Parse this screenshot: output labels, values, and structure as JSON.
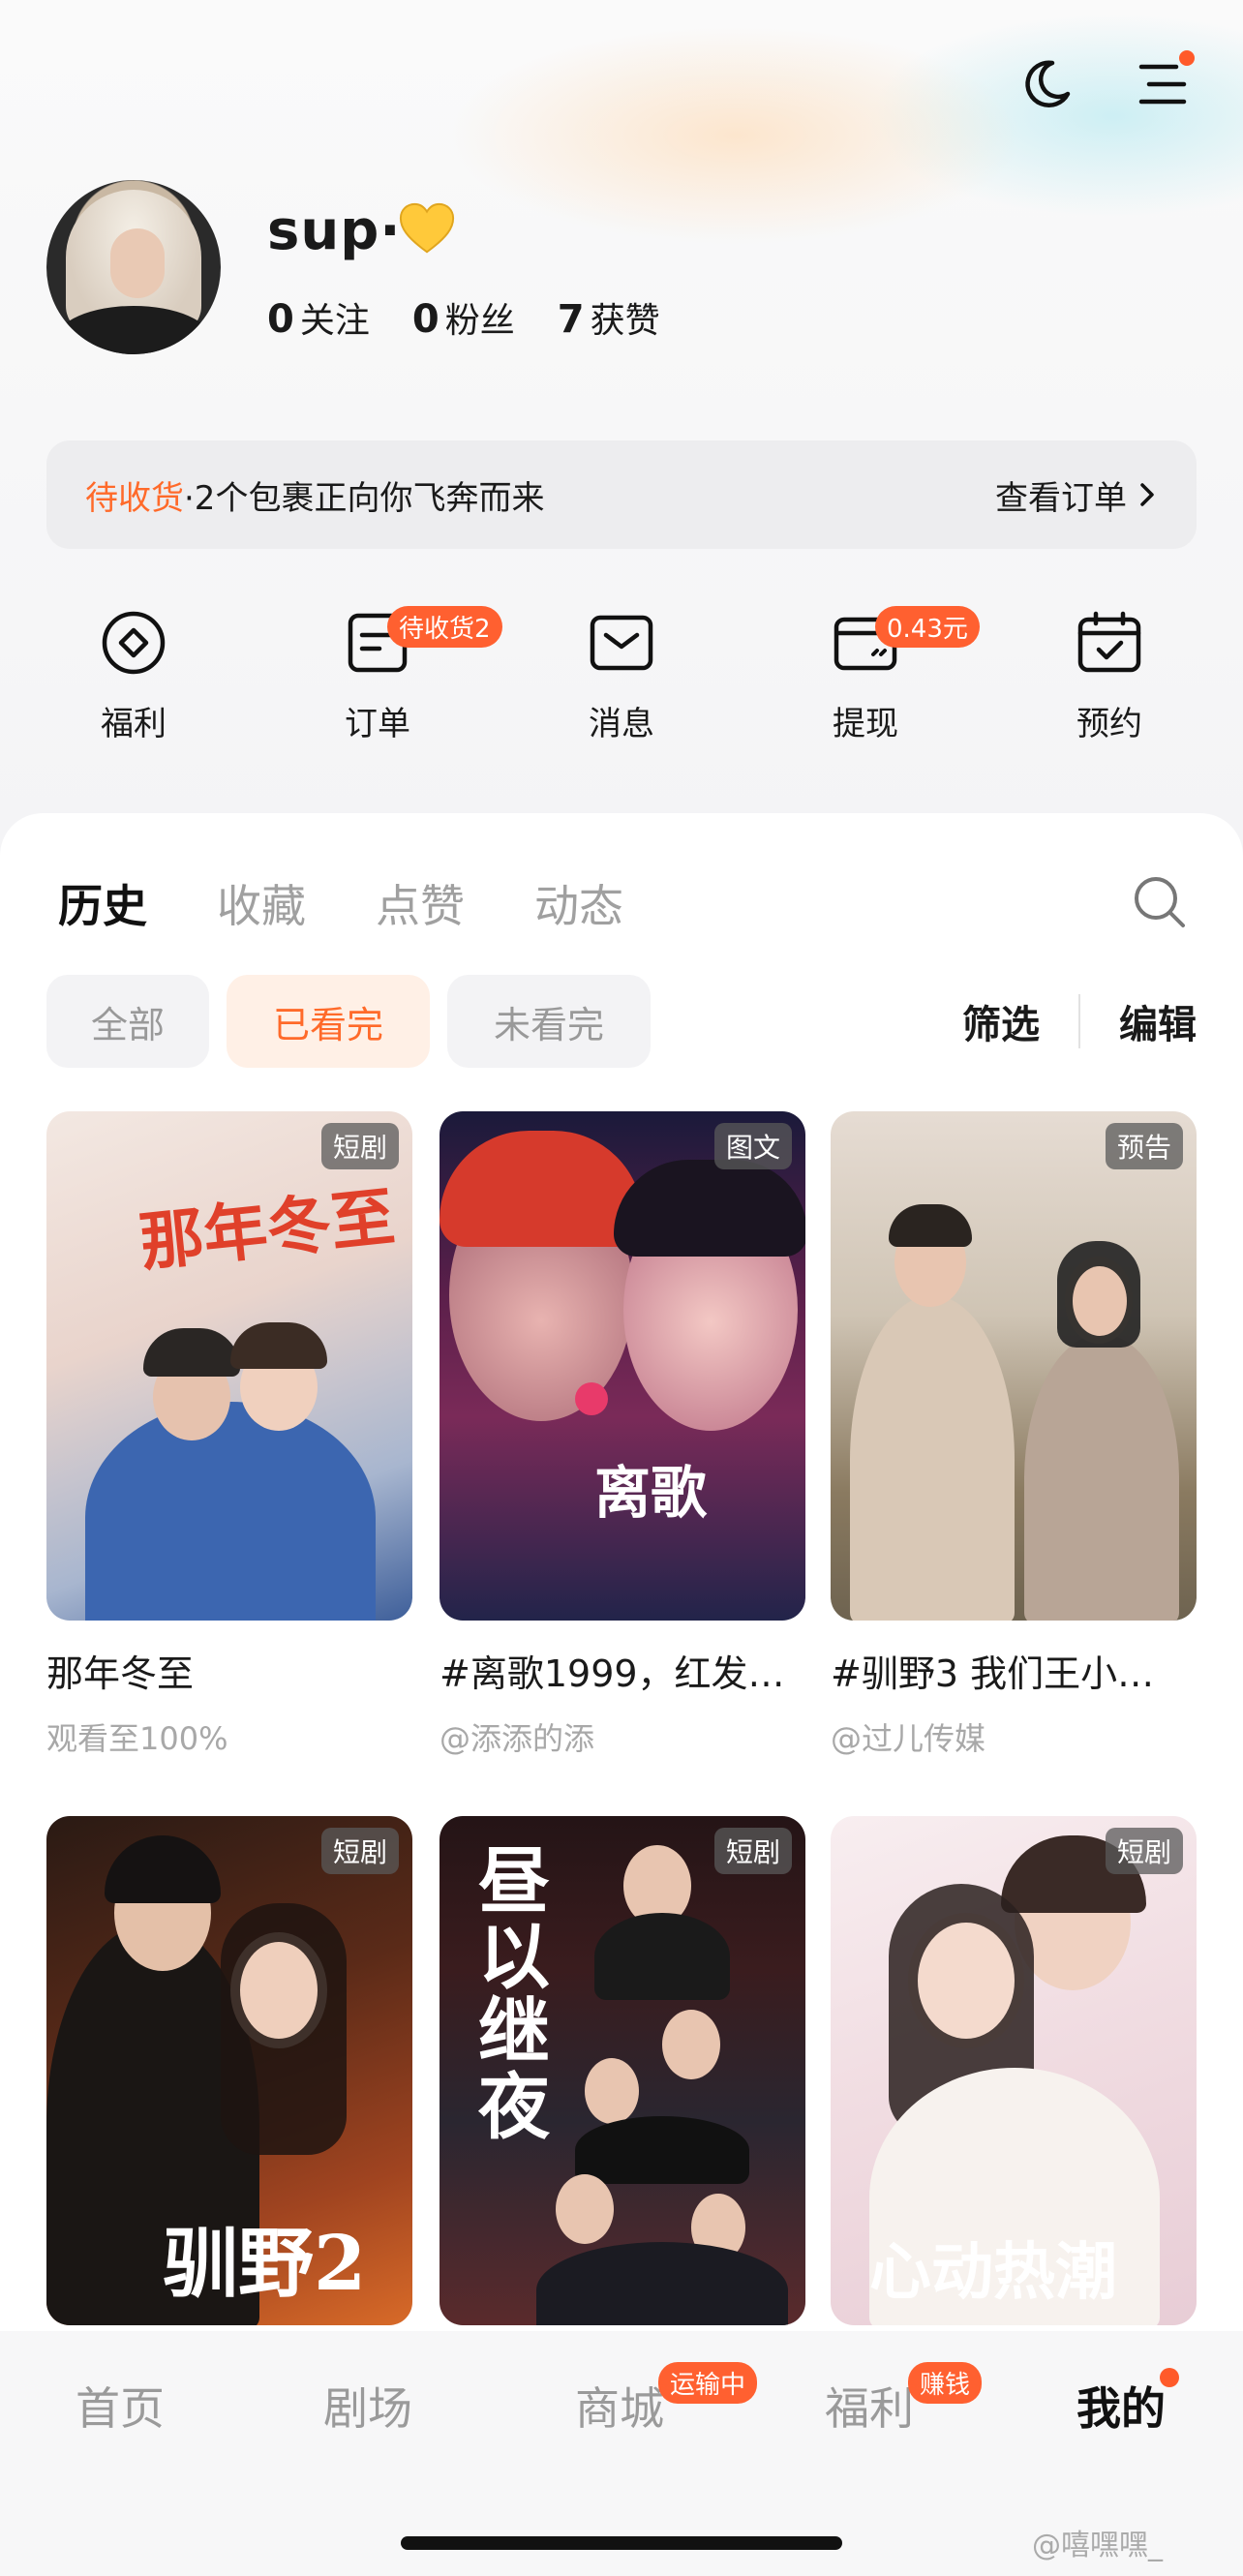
{
  "header": {
    "dark_mode_icon": "moon-icon",
    "menu_icon": "menu-icon"
  },
  "profile": {
    "username": "sup·",
    "stats": [
      {
        "num": "0",
        "label": "关注"
      },
      {
        "num": "0",
        "label": "粉丝"
      },
      {
        "num": "7",
        "label": "获赞"
      }
    ]
  },
  "banner": {
    "status": "待收货",
    "message": "·2个包裹正向你飞奔而来",
    "action": "查看订单"
  },
  "shortcuts": [
    {
      "label": "福利",
      "icon": "coin-icon",
      "badge": ""
    },
    {
      "label": "订单",
      "icon": "order-icon",
      "badge": "待收货2"
    },
    {
      "label": "消息",
      "icon": "message-icon",
      "badge": ""
    },
    {
      "label": "提现",
      "icon": "wallet-icon",
      "badge": "0.43元"
    },
    {
      "label": "预约",
      "icon": "calendar-icon",
      "badge": ""
    }
  ],
  "tabs": [
    "历史",
    "收藏",
    "点赞",
    "动态"
  ],
  "filters": {
    "chips": [
      "全部",
      "已看完",
      "未看完"
    ],
    "screen": "筛选",
    "edit": "编辑"
  },
  "items": [
    {
      "tag": "短剧",
      "title": "那年冬至",
      "sub": "观看至100%",
      "poster_text": "那年冬至"
    },
    {
      "tag": "图文",
      "title": "#离歌1999，红发…",
      "sub": "@添添的添",
      "poster_text": "离歌"
    },
    {
      "tag": "预告",
      "title": "#驯野3   我们王小…",
      "sub": "@过儿传媒",
      "poster_text": ""
    },
    {
      "tag": "短剧",
      "title": "",
      "sub": "",
      "poster_text": "驯野2"
    },
    {
      "tag": "短剧",
      "title": "",
      "sub": "",
      "poster_text": "昼以继夜"
    },
    {
      "tag": "短剧",
      "title": "",
      "sub": "",
      "poster_text": "心动热潮"
    }
  ],
  "nav": {
    "items": [
      "首页",
      "剧场",
      "商城",
      "福利",
      "我的"
    ],
    "mall_badge": "运输中",
    "welfare_badge": "赚钱"
  },
  "watermark": "@嘻嘿嘿_",
  "colors": {
    "accent": "#ff6a2a",
    "badge": "#ff6030"
  }
}
